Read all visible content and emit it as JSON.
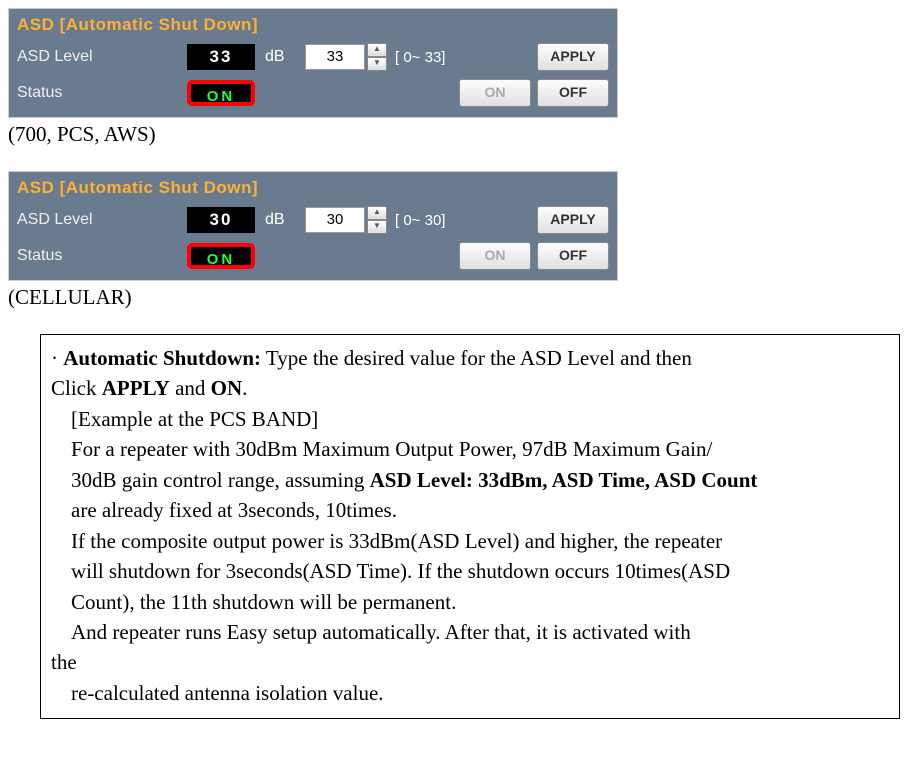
{
  "panel1": {
    "title": "ASD [Automatic Shut Down]",
    "level_label": "ASD Level",
    "level_value": "33",
    "unit": "dB",
    "input_value": "33",
    "range": "[ 0~ 33]",
    "apply": "APPLY",
    "status_label": "Status",
    "status_value": "ON",
    "on": "ON",
    "off": "OFF"
  },
  "caption1": "(700, PCS, AWS)",
  "panel2": {
    "title": "ASD [Automatic Shut Down]",
    "level_label": "ASD Level",
    "level_value": "30",
    "unit": "dB",
    "input_value": "30",
    "range": "[ 0~ 30]",
    "apply": "APPLY",
    "status_label": "Status",
    "status_value": "ON",
    "on": "ON",
    "off": "OFF"
  },
  "caption2": "(CELLULAR)",
  "desc": {
    "bullet": "·",
    "title": "Automatic Shutdown:",
    "l1": " Type the desired value for the ASD Level and then",
    "l2a": "Click ",
    "l2b": "APPLY",
    "l2c": " and ",
    "l2d": "ON",
    "l2e": ".",
    "l3": "[Example at the PCS BAND]",
    "l4": "For a repeater with 30dBm Maximum Output Power, 97dB Maximum Gain/",
    "l5a": "30dB gain control range, assuming ",
    "l5b": "ASD Level: 33dBm, ASD Time, ASD Count",
    "l6": "are already fixed  at 3seconds, 10times.",
    "l7": "If the composite output power is 33dBm(ASD Level) and higher, the repeater",
    "l8": "will shutdown for 3seconds(ASD Time). If the shutdown occurs 10times(ASD",
    "l9": "Count), the 11th shutdown will be permanent.",
    "l10": "And repeater runs Easy setup automatically. After that, it is activated with",
    "l11": "the",
    "l12": "re-calculated antenna isolation value."
  }
}
